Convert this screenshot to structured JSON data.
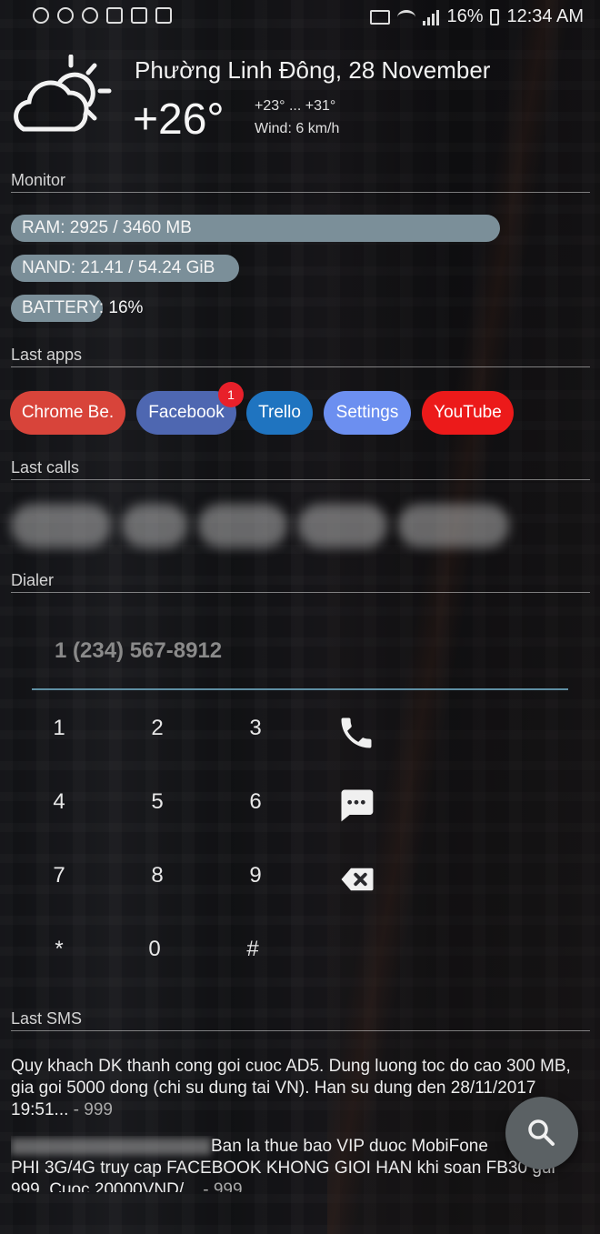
{
  "status_bar": {
    "left_icons": [
      "messenger-icon",
      "chat-icon",
      "minus-circle-icon",
      "twitter-icon",
      "flag-icon",
      "play-store-icon"
    ],
    "right_icons": [
      "cast-icon",
      "wifi-icon",
      "signal-icon"
    ],
    "battery_percent": "16%",
    "time": "12:34 AM"
  },
  "weather": {
    "icon": "partly-cloudy-icon",
    "location_date": "Phường Linh Đông, 28 November",
    "temperature": "+26°",
    "range": "+23° ... +31°",
    "wind": "Wind: 6 km/h"
  },
  "monitor": {
    "title": "Monitor",
    "ram": {
      "label": "RAM:",
      "value": "2925 / 3460 MB",
      "fraction": 0.845
    },
    "nand": {
      "label": "NAND:",
      "value": "21.41 / 54.24 GiB",
      "fraction": 0.395
    },
    "battery": {
      "label": "BATTERY:",
      "value": "16%",
      "fraction": 0.16
    }
  },
  "last_apps": {
    "title": "Last apps",
    "items": [
      {
        "label": "Chrome Be.",
        "color": "#d8443a"
      },
      {
        "label": "Facebook",
        "color": "#4e67b1",
        "badge": "1"
      },
      {
        "label": "Trello",
        "color": "#1f74c0"
      },
      {
        "label": "Settings",
        "color": "#6c8ff0"
      },
      {
        "label": "YouTube",
        "color": "#ec1a1a"
      }
    ]
  },
  "last_calls": {
    "title": "Last calls"
  },
  "dialer": {
    "title": "Dialer",
    "placeholder": "1 (234) 567-8912",
    "keys": [
      "1",
      "2",
      "3",
      "4",
      "5",
      "6",
      "7",
      "8",
      "9",
      "*",
      "0",
      "#"
    ],
    "actions": [
      "phone-icon",
      "message-icon",
      "backspace-icon"
    ]
  },
  "last_sms": {
    "title": "Last SMS",
    "messages": [
      {
        "text": "Quy khach DK thanh cong goi cuoc AD5. Dung luong toc do cao 300 MB, gia goi 5000 dong (chi su dung tai VN). Han su dung den 28/11/2017 19:51...",
        "from": " - 999"
      },
      {
        "text": "Ban la thue bao VIP duoc MobiFone",
        "text2": "PHI 3G/4G truy cap FACEBOOK KHONG GIOI HAN khi soan FB30 gui 999. Cuoc 20000VND/...",
        "from": " - 999"
      }
    ]
  },
  "fab": {
    "icon": "search-icon"
  }
}
